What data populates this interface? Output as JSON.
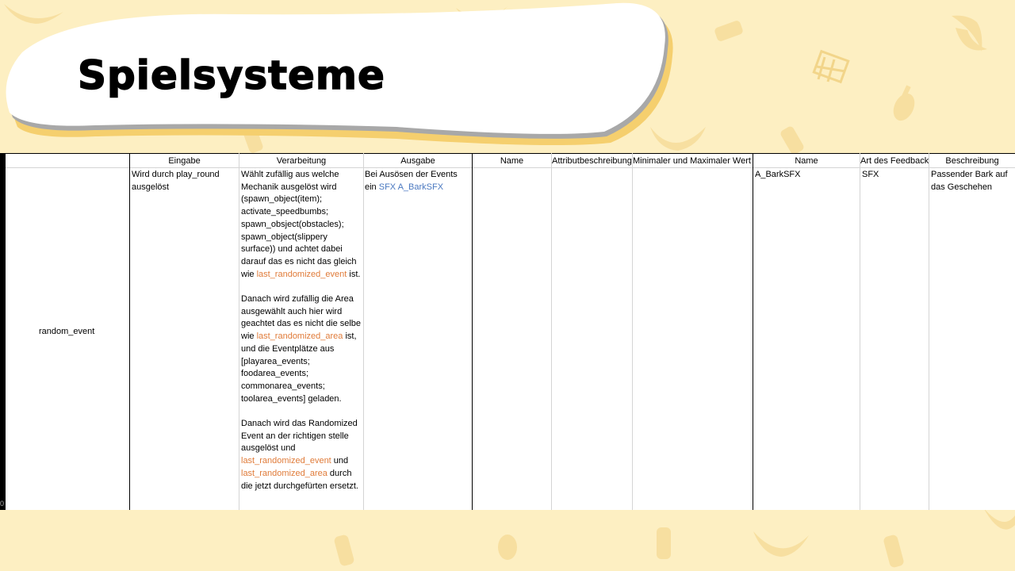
{
  "slide": {
    "title": "Spielsysteme"
  },
  "table": {
    "headers": {
      "eingabe": "Eingabe",
      "verarbeitung": "Verarbeitung",
      "ausgabe": "Ausgabe",
      "name1": "Name",
      "attribut": "Attributbeschreibung",
      "minmax": "Minimaler und Maximaler Wert",
      "name2": "Name",
      "art": "Art des Feedbacks",
      "beschreibung": "Beschreibung"
    },
    "row_label": "random_event",
    "eingabe": "Wird durch play_round ausgelöst",
    "verarbeitung": {
      "p1_a": "Wählt zufällig aus welche Mechanik ausgelöst wird (spawn_object(item); activate_speedbumbs; spawn_obsject(obstacles); spawn_object(slippery surface)) und achtet dabei darauf das es nicht das gleich wie ",
      "p1_hl": "last_randomized_event",
      "p1_b": " ist.",
      "p2_a": "Danach wird zufällig die Area ausgewählt auch hier wird geachtet das es nicht die selbe wie ",
      "p2_hl": "last_randomized_area",
      "p2_b": " ist, und die Eventplätze aus [playarea_events; foodarea_events; commonarea_events; toolarea_events] geladen.",
      "p3_a": "Danach wird das Randomized Event an der richtigen stelle ausgelöst und ",
      "p3_hl1": "last_randomized_event",
      "p3_mid": " und ",
      "p3_hl2": "last_randomized_area",
      "p3_b": " durch die jetzt durchgefürten ersetzt."
    },
    "ausgabe_a": "Bei Ausösen der Events ein ",
    "ausgabe_hl": "SFX A_BarkSFX",
    "feedback_name": "A_BarkSFX",
    "feedback_art": "SFX",
    "feedback_beschreibung": "Passender Bark auf das Geschehen",
    "edge_number": "0"
  },
  "colors": {
    "background": "#fdefc2",
    "highlight_orange": "#e07b39",
    "highlight_blue": "#4a78c0"
  },
  "decor_icons": [
    "banana-icon",
    "bottle-icon",
    "shopping-cart-icon",
    "chicken-leg-icon"
  ]
}
